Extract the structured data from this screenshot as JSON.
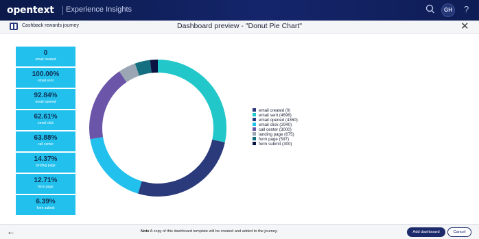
{
  "header": {
    "brand": "opentext",
    "product": "Experience Insights",
    "avatar_initials": "GH",
    "help": "?"
  },
  "subbar": {
    "journey_name": "Cashback rewards journey",
    "dialog_title": "Dashboard preview - \"Donut Pie Chart\"",
    "close": "✕"
  },
  "kpis": [
    {
      "value": "0",
      "label": "email created"
    },
    {
      "value": "100.00%",
      "label": "email sent"
    },
    {
      "value": "92.84%",
      "label": "email opened"
    },
    {
      "value": "62.61%",
      "label": "email click"
    },
    {
      "value": "63.88%",
      "label": "call center"
    },
    {
      "value": "14.37%",
      "label": "landing page"
    },
    {
      "value": "12.71%",
      "label": "form page"
    },
    {
      "value": "6.39%",
      "label": "form submit"
    }
  ],
  "chart_data": {
    "type": "pie",
    "donut": true,
    "legend_position": "right",
    "categories": [
      "email created",
      "email sent",
      "email opened",
      "email click",
      "call center",
      "landing page",
      "form page",
      "form submit"
    ],
    "values": [
      0,
      4696,
      4360,
      2940,
      3000,
      675,
      597,
      300
    ],
    "legend_labels": [
      "email created (0)",
      "email sent (4696)",
      "email opened (4360)",
      "email click (2940)",
      "call center (3000)",
      "landing page (675)",
      "form page (597)",
      "form submit (300)"
    ],
    "colors": [
      "#2b3a7a",
      "#22c7c9",
      "#2b3a7a",
      "#22c0ed",
      "#6b55a8",
      "#9aa6b3",
      "#147080",
      "#0b1440"
    ]
  },
  "footer": {
    "note_bold": "Note",
    "note_text": " A copy of this dashboard template will be created and added to the journey.",
    "add_label": "Add dashboard",
    "cancel_label": "Cancel"
  }
}
